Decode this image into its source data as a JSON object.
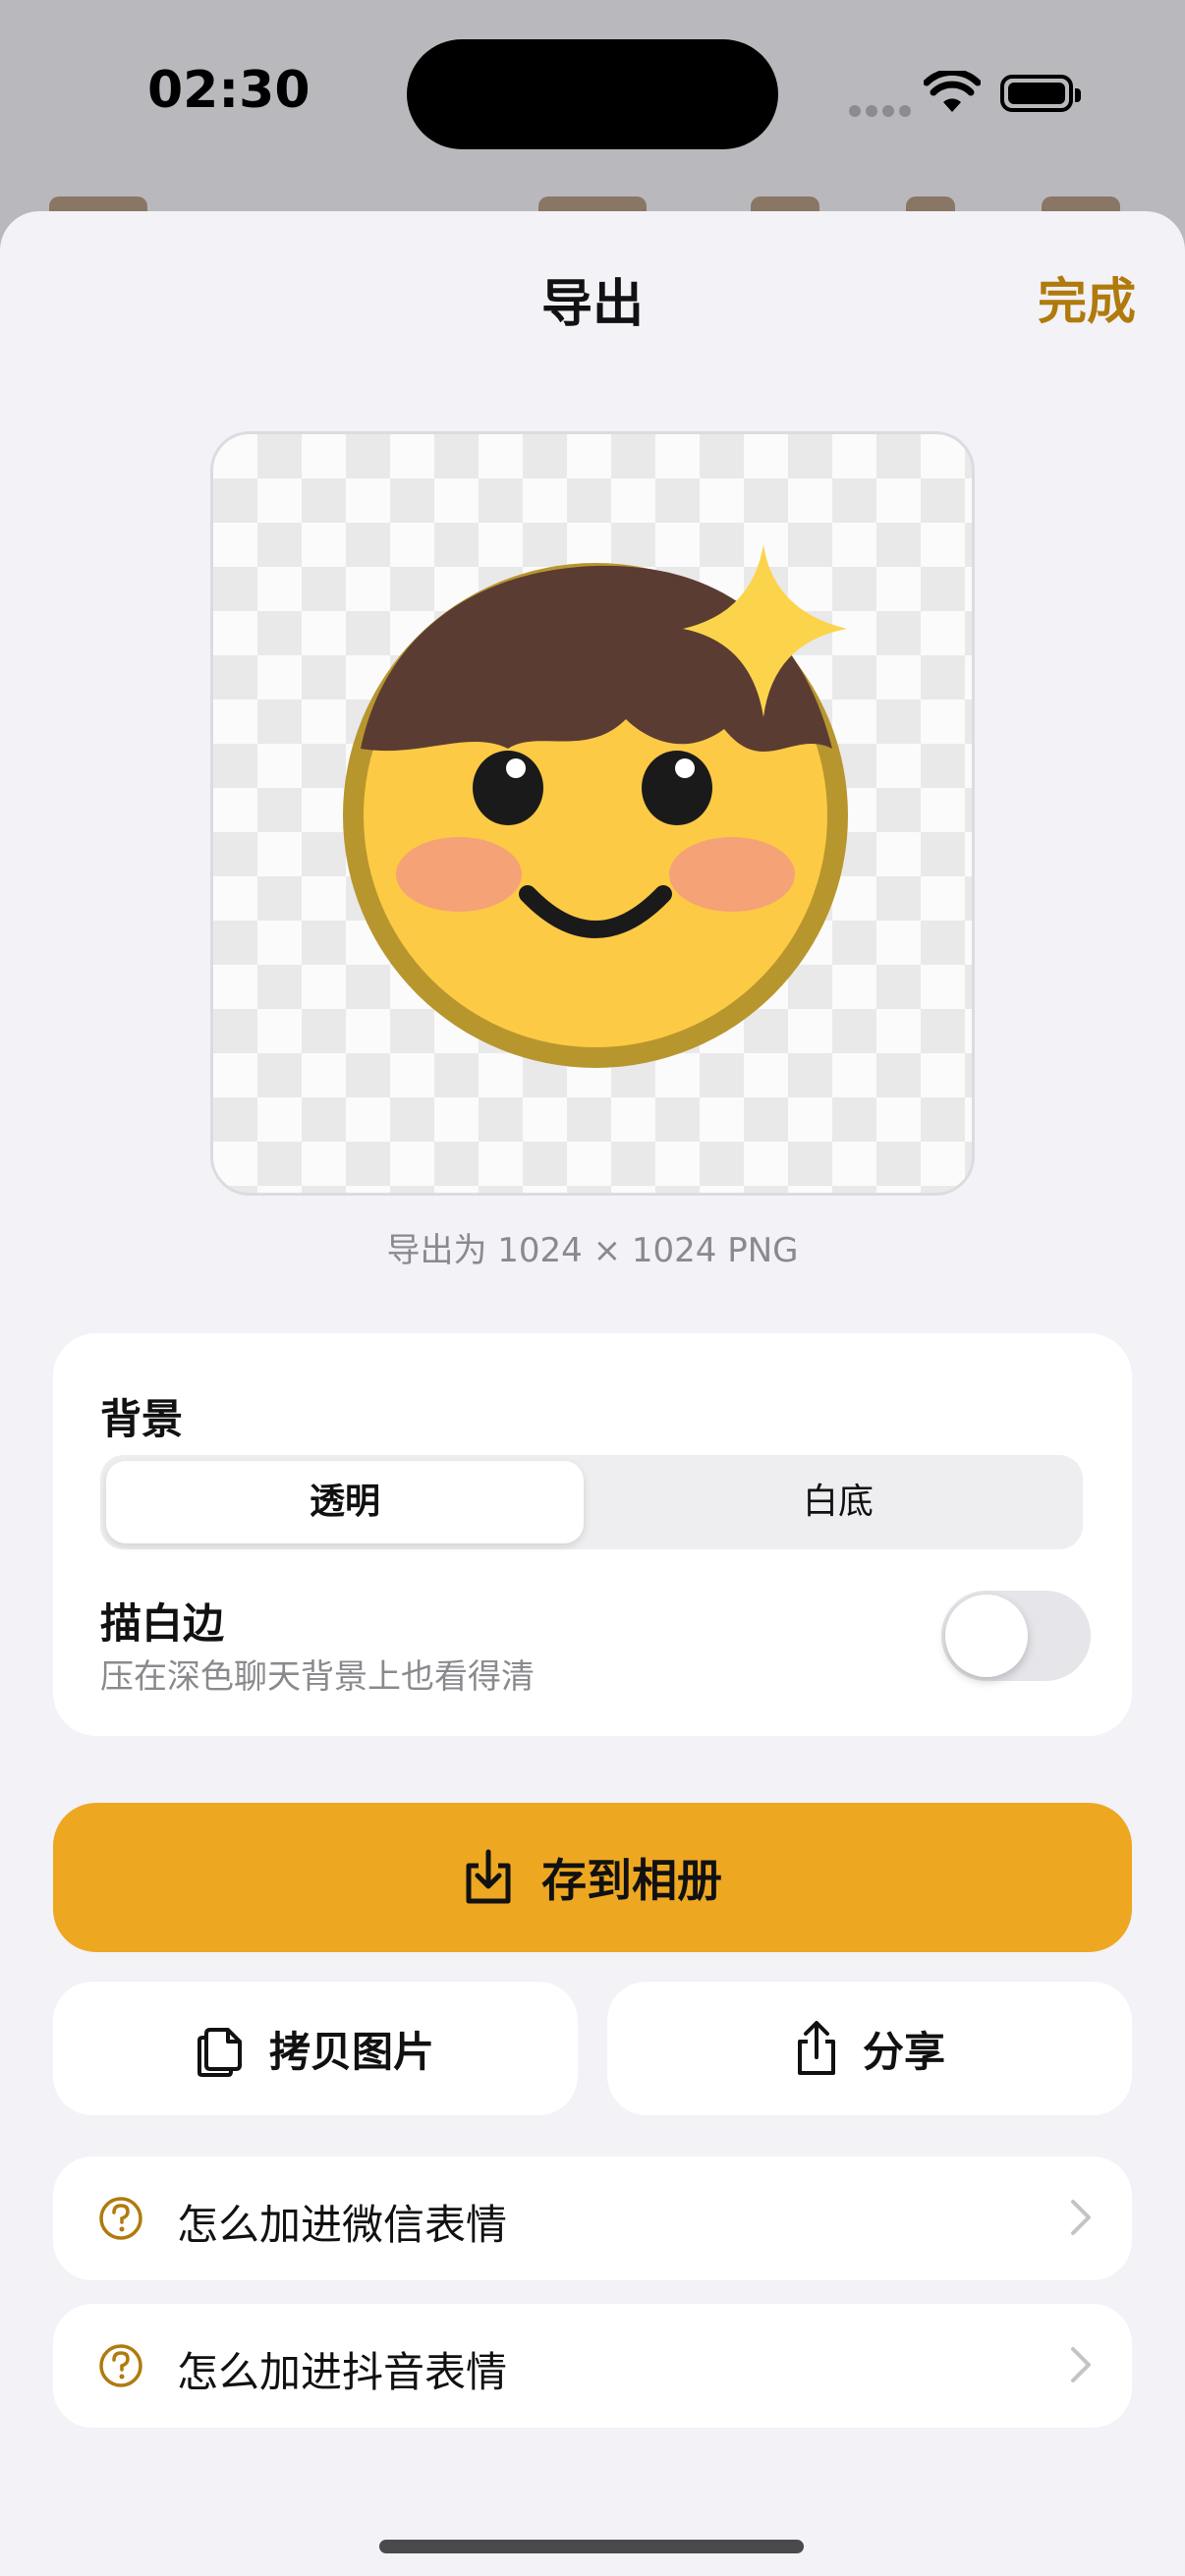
{
  "status_bar": {
    "time": "02:30"
  },
  "sheet": {
    "title": "导出",
    "done_label": "完成",
    "caption": "导出为 1024 × 1024 PNG"
  },
  "settings": {
    "background_label": "背景",
    "options": [
      "透明",
      "白底"
    ],
    "selected_option": "透明",
    "stroke_title": "描白边",
    "stroke_subtitle": "压在深色聊天背景上也看得清",
    "stroke_enabled": false
  },
  "actions": {
    "save_label": "存到相册",
    "copy_label": "拷贝图片",
    "share_label": "分享"
  },
  "help": [
    {
      "label": "怎么加进微信表情"
    },
    {
      "label": "怎么加进抖音表情"
    }
  ],
  "colors": {
    "accent": "#eea721",
    "accent_text": "#b07a0c",
    "sheet_bg": "#f2f2f7"
  }
}
